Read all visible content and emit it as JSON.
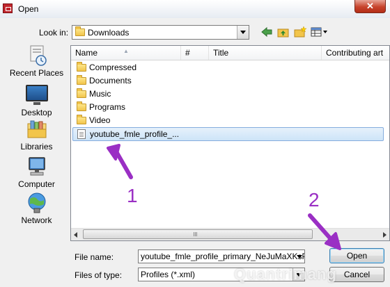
{
  "window": {
    "title": "Open",
    "close_glyph": "✕"
  },
  "lookin": {
    "label": "Look in:",
    "value": "Downloads"
  },
  "places": [
    {
      "label": "Recent Places",
      "icon": "recent-places-icon"
    },
    {
      "label": "Desktop",
      "icon": "desktop-icon"
    },
    {
      "label": "Libraries",
      "icon": "libraries-icon"
    },
    {
      "label": "Computer",
      "icon": "computer-icon"
    },
    {
      "label": "Network",
      "icon": "network-icon"
    }
  ],
  "columns": {
    "name": "Name",
    "number": "#",
    "title": "Title",
    "contributing": "Contributing art"
  },
  "files": [
    {
      "name": "Compressed",
      "type": "folder"
    },
    {
      "name": "Documents",
      "type": "folder"
    },
    {
      "name": "Music",
      "type": "folder"
    },
    {
      "name": "Programs",
      "type": "folder"
    },
    {
      "name": "Video",
      "type": "folder"
    },
    {
      "name": "youtube_fmle_profile_...",
      "type": "file",
      "selected": true
    }
  ],
  "form": {
    "filename_label": "File name:",
    "filename_value": "youtube_fmle_profile_primary_NeJuMaXKsPw.x",
    "filetype_label": "Files of type:",
    "filetype_value": "Profiles (*.xml)"
  },
  "buttons": {
    "open": "Open",
    "cancel": "Cancel"
  },
  "annotations": {
    "step1": "1",
    "step2": "2",
    "color": "#9a2fc4"
  },
  "watermark": "Quantrimang"
}
